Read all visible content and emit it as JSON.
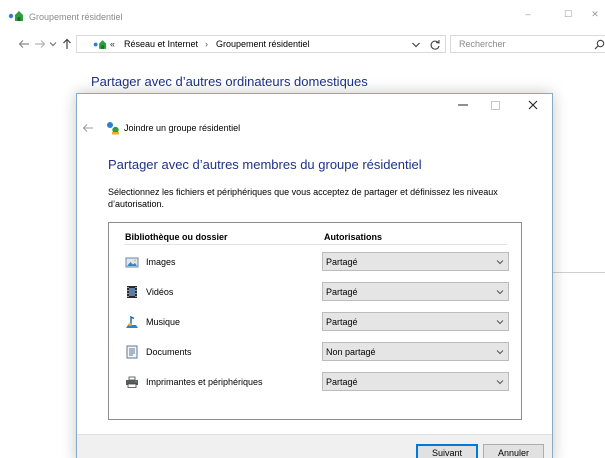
{
  "window": {
    "title": "Groupement résidentiel",
    "minimize_glyph": "–",
    "maximize_glyph": "☐",
    "close_glyph": "✕"
  },
  "navigation": {
    "back_icon": "arrow-left-icon",
    "forward_icon": "arrow-right-icon",
    "recent_icon": "chevron-down-icon",
    "up_icon": "arrow-up-icon"
  },
  "addressbar": {
    "overflow": "«",
    "crumbs": [
      "Réseau et Internet",
      "Groupement résidentiel"
    ],
    "separator": "›",
    "refresh_icon": "refresh-icon"
  },
  "search": {
    "placeholder": "Rechercher",
    "icon": "search-icon"
  },
  "background": {
    "heading": "Partager avec d’autres ordinateurs domestiques"
  },
  "dialog": {
    "title": "Joindre un groupe résidentiel",
    "heading": "Partager avec d’autres membres du groupe résidentiel",
    "description": "Sélectionnez les fichiers et périphériques que vous acceptez de partager et définissez les niveaux d’autorisation.",
    "columns": {
      "library": "Bibliothèque ou dossier",
      "permissions": "Autorisations"
    },
    "rows": [
      {
        "label": "Images",
        "icon": "images-icon",
        "permission": "Partagé"
      },
      {
        "label": "Vidéos",
        "icon": "videos-icon",
        "permission": "Partagé"
      },
      {
        "label": "Musique",
        "icon": "music-icon",
        "permission": "Partagé"
      },
      {
        "label": "Documents",
        "icon": "documents-icon",
        "permission": "Non partagé"
      },
      {
        "label": "Imprimantes et périphériques",
        "icon": "printer-icon",
        "permission": "Partagé"
      }
    ],
    "buttons": {
      "next": "Suivant",
      "cancel": "Annuler"
    }
  },
  "colors": {
    "heading_blue": "#1e3287",
    "accent": "#0078d7",
    "select_bg": "#e5e5e5",
    "footer_bg": "#f0f0f0"
  }
}
